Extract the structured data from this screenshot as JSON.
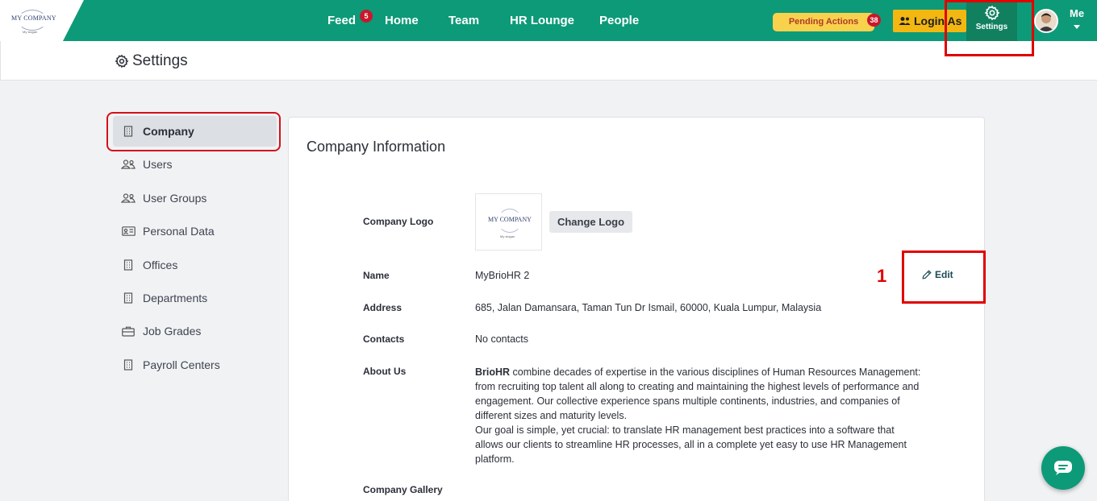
{
  "brand": {
    "logo_text": "MY COMPANY",
    "logo_subtext": "My slogan",
    "accent": "#0d9a78"
  },
  "nav": {
    "items": [
      {
        "label": "Feed",
        "badge": "5"
      },
      {
        "label": "Home"
      },
      {
        "label": "Team"
      },
      {
        "label": "HR Lounge"
      },
      {
        "label": "People"
      }
    ],
    "pending_actions": {
      "label": "Pending Actions",
      "badge": "38"
    },
    "login_as": "Login As",
    "settings": "Settings",
    "me": "Me"
  },
  "page": {
    "title": "Settings"
  },
  "sidebar": {
    "items": [
      {
        "label": "Company",
        "icon": "building-icon",
        "active": true
      },
      {
        "label": "Users",
        "icon": "users-icon"
      },
      {
        "label": "User Groups",
        "icon": "users-icon"
      },
      {
        "label": "Personal Data",
        "icon": "id-card-icon"
      },
      {
        "label": "Offices",
        "icon": "building-icon"
      },
      {
        "label": "Departments",
        "icon": "building-icon"
      },
      {
        "label": "Job Grades",
        "icon": "briefcase-icon"
      },
      {
        "label": "Payroll Centers",
        "icon": "building-icon"
      }
    ]
  },
  "company": {
    "title": "Company Information",
    "logo_label": "Company Logo",
    "change_logo": "Change Logo",
    "edit": "Edit",
    "name_label": "Name",
    "name_value": "MyBrioHR 2",
    "address_label": "Address",
    "address_value": "685, Jalan Damansara, Taman Tun Dr Ismail, 60000, Kuala Lumpur, Malaysia",
    "contacts_label": "Contacts",
    "contacts_value": "No contacts",
    "about_label": "About Us",
    "about_brand": "BrioHR",
    "about_p1": " combine decades of expertise in the various disciplines of Human Resources Management: from recruiting top talent all along to creating and maintaining the highest levels of performance and engagement. Our collective experience spans multiple continents, industries, and companies of different sizes and maturity levels.",
    "about_p2": "Our goal is simple, yet crucial: to translate HR management best practices into a software that allows our clients to streamline HR processes, all in a complete yet easy to use HR Management platform.",
    "gallery_label": "Company Gallery"
  },
  "annotation": {
    "step_number": "1"
  }
}
